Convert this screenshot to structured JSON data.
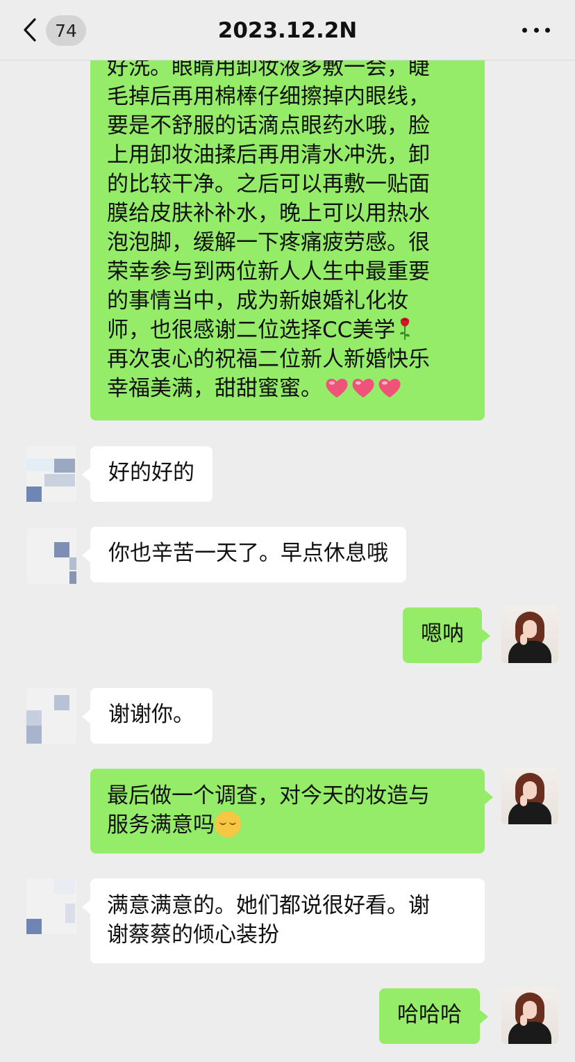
{
  "header": {
    "unread_count": "74",
    "title": "2023.12.2N"
  },
  "messages": [
    {
      "from": "me",
      "text": "好洗。眼睛用卸妆液多敷一会，睫毛掉后再用棉棒仔细擦掉内眼线，要是不舒服的话滴点眼药水哦，脸上用卸妆油揉后再用清水冲洗，卸的比较干净。之后可以再敷一贴面膜给皮肤补补水，晚上可以用热水泡泡脚，缓解一下疼痛疲劳感。很荣幸参与到两位新人人生中最重要的事情当中，成为新娘婚礼化妆师，也很感谢二位选择CC美学",
      "text_tail": "再次衷心的祝福二位新人新婚快乐幸福美满，甜甜蜜蜜。",
      "lines": [
        "好洗。眼睛用卸妆液多敷一会，睫",
        "毛掉后再用棉棒仔细擦掉内眼线，",
        "要是不舒服的话滴点眼药水哦，脸",
        "上用卸妆油揉后再用清水冲洗，卸",
        "的比较干净。之后可以再敷一贴面",
        "膜给皮肤补补水，晚上可以用热水",
        "泡泡脚，缓解一下疼痛疲劳感。很",
        "荣幸参与到两位新人人生中最重要",
        "的事情当中，成为新娘婚礼化妆",
        "师，也很感谢二位选择CC美学",
        "再次衷心的祝福二位新人新婚快乐",
        "幸福美满，甜甜蜜蜜。"
      ],
      "emojis": [
        "rose",
        "heart",
        "heart",
        "heart"
      ]
    },
    {
      "from": "them",
      "text": "好的好的"
    },
    {
      "from": "them",
      "text": "你也辛苦一天了。早点休息哦"
    },
    {
      "from": "me",
      "text": "嗯呐"
    },
    {
      "from": "them",
      "text": "谢谢你。"
    },
    {
      "from": "me",
      "text_line1": "最后做一个调查，对今天的妆造与",
      "text_line2": "服务满意吗",
      "emoji": "smiling-face"
    },
    {
      "from": "them",
      "text_line1": "满意满意的。她们都说很好看。谢",
      "text_line2": "谢蔡蔡的倾心装扮"
    },
    {
      "from": "me",
      "text": "哈哈哈"
    }
  ],
  "colors": {
    "background": "#ededed",
    "outgoing_bubble": "#95ec69",
    "incoming_bubble": "#ffffff"
  }
}
